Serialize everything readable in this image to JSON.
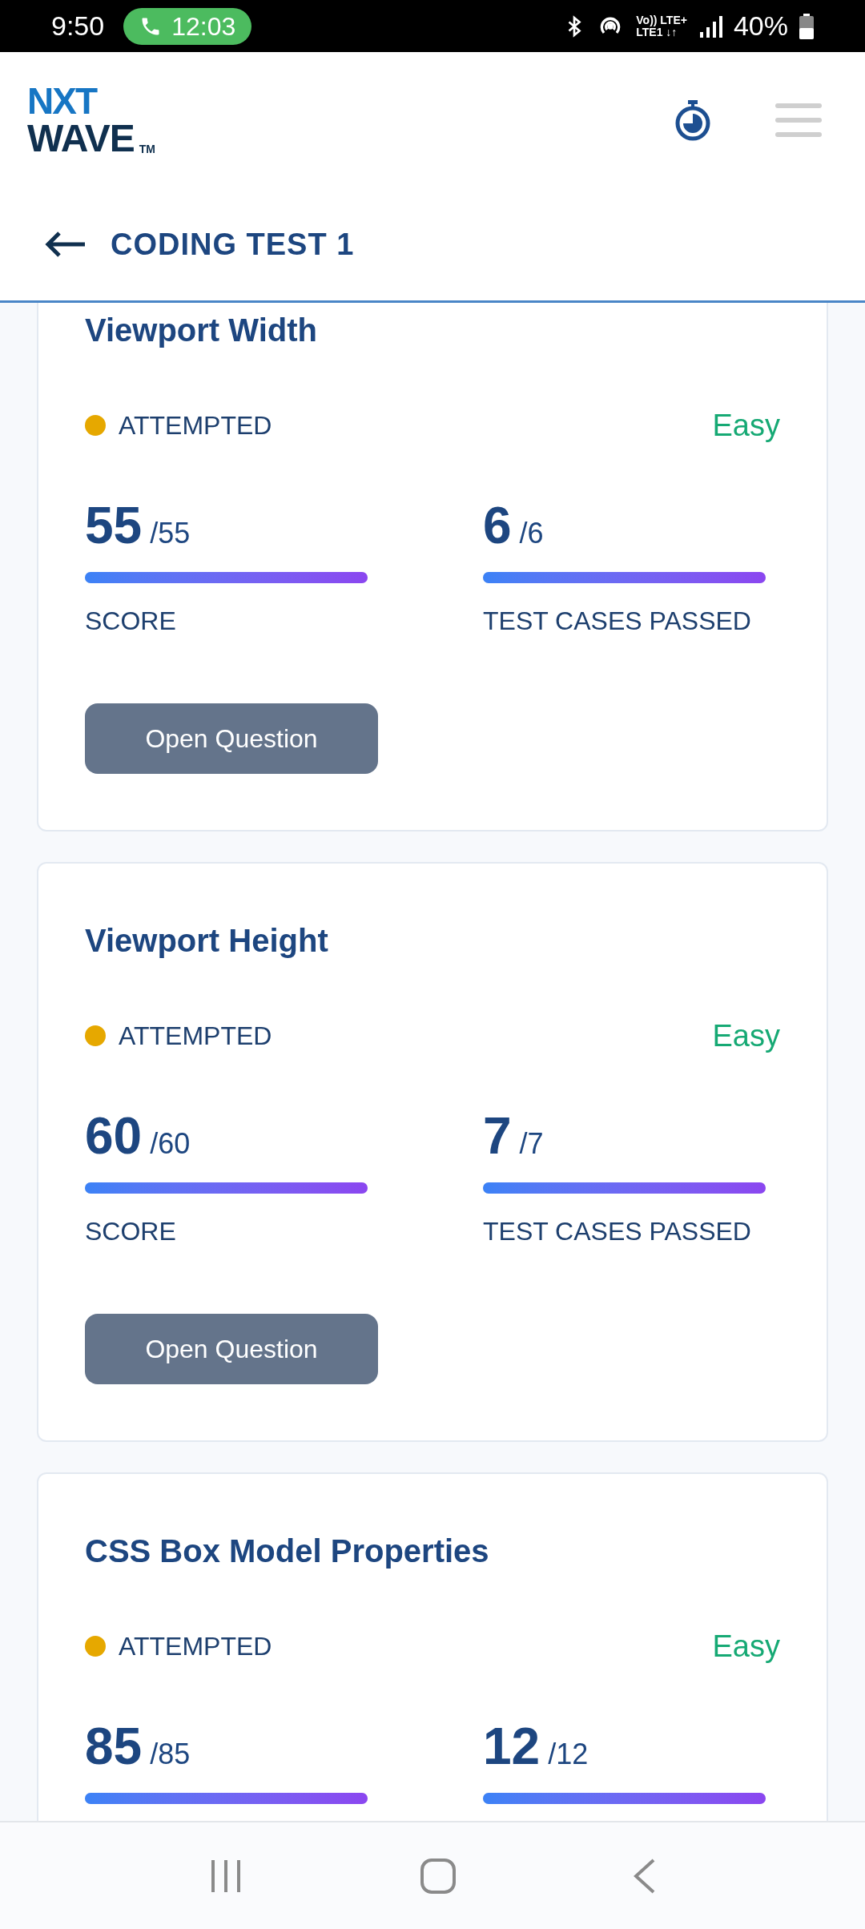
{
  "status_bar": {
    "time": "9:50",
    "call_timer": "12:03",
    "network_top": "Vo)) LTE+",
    "network_bottom": "LTE1 ↓↑",
    "battery": "40%"
  },
  "header": {
    "logo": {
      "line_1": "NXT",
      "line_2": "WAVE",
      "trademark": "TM"
    }
  },
  "page_title": "CODING TEST 1",
  "questions": [
    {
      "title": "Viewport Width",
      "status": "ATTEMPTED",
      "color": "#e6a800",
      "difficulty": "Easy",
      "score": "55",
      "score_total": "/55",
      "score_bar": {
        "level": 1
      },
      "score_label": "SCORE",
      "tests": "6",
      "tests_total": "/6",
      "tests_bar": {
        "level": 1
      },
      "tests_label": "TEST CASES PASSED",
      "button": "Open Question"
    },
    {
      "title": "Viewport Height",
      "status": "ATTEMPTED",
      "color": "#e6a800",
      "difficulty": "Easy",
      "score": "60",
      "score_total": "/60",
      "score_bar": {
        "level": 1
      },
      "score_label": "SCORE",
      "tests": "7",
      "tests_total": "/7",
      "tests_bar": {
        "level": 1
      },
      "tests_label": "TEST CASES PASSED",
      "button": "Open Question"
    },
    {
      "title": "CSS Box Model Properties",
      "status": "ATTEMPTED",
      "color": "#e6a800",
      "difficulty": "Easy",
      "score": "85",
      "score_total": "/85",
      "score_bar": {
        "level": 1
      },
      "tests": "12",
      "tests_total": "/12",
      "tests_bar": {
        "level": 1
      }
    }
  ]
}
